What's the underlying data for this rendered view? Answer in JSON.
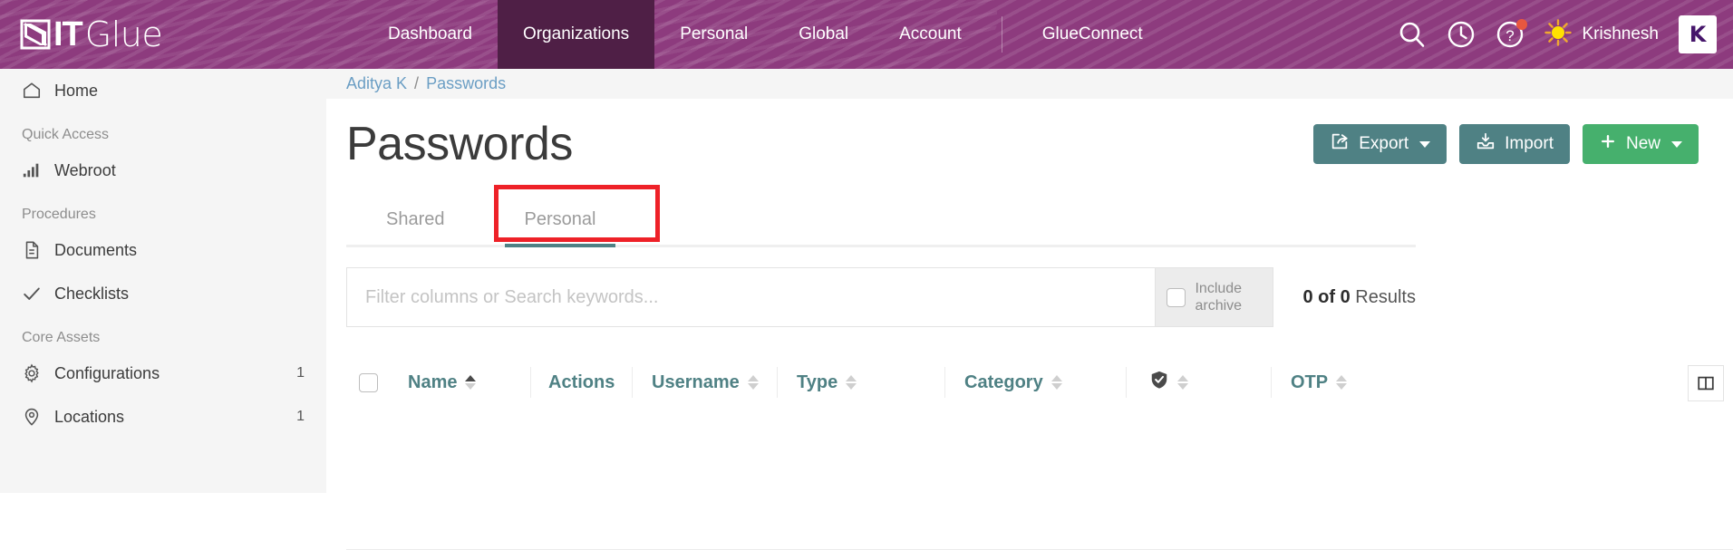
{
  "brand": {
    "logo_it": "IT",
    "logo_glue": "Glue",
    "purple": "#8d3b7e",
    "active_purple": "#4f1f46",
    "teal": "#4f8184",
    "green": "#46b06d",
    "annotation_red": "#ee2128"
  },
  "header": {
    "nav": [
      {
        "label": "Dashboard",
        "active": false
      },
      {
        "label": "Organizations",
        "active": true
      },
      {
        "label": "Personal",
        "active": false
      },
      {
        "label": "Global",
        "active": false
      },
      {
        "label": "Account",
        "active": false
      },
      {
        "label": "GlueConnect",
        "active": false
      }
    ],
    "icons": [
      "search-icon",
      "recent-history-icon",
      "help-icon"
    ],
    "help_has_notification": true,
    "user_name": "Krishnesh",
    "avatar_icon": "sun-avatar-icon",
    "kaseya_logo_letter": "K"
  },
  "sidebar": {
    "items": [
      {
        "label": "Home",
        "icon": "home-icon",
        "count": "",
        "group": false
      },
      {
        "label": "Quick Access",
        "icon": "",
        "count": "",
        "group": true
      },
      {
        "label": "Webroot",
        "icon": "signal-bars-icon",
        "count": "",
        "group": false
      },
      {
        "label": "Procedures",
        "icon": "",
        "count": "",
        "group": true
      },
      {
        "label": "Documents",
        "icon": "document-icon",
        "count": "",
        "group": false
      },
      {
        "label": "Checklists",
        "icon": "check-icon",
        "count": "",
        "group": false
      },
      {
        "label": "Core Assets",
        "icon": "",
        "count": "",
        "group": true
      },
      {
        "label": "Configurations",
        "icon": "gear-icon",
        "count": "1",
        "group": false
      },
      {
        "label": "Locations",
        "icon": "location-pin-icon",
        "count": "1",
        "group": false
      }
    ]
  },
  "breadcrumb": {
    "org": "Aditya K",
    "separator": "/",
    "current": "Passwords"
  },
  "main": {
    "title": "Passwords",
    "buttons": [
      {
        "label": "Export",
        "icon": "export-icon",
        "style": "teal",
        "caret": true
      },
      {
        "label": "Import",
        "icon": "import-icon",
        "style": "teal",
        "caret": false
      },
      {
        "label": "New",
        "icon": "plus-icon",
        "style": "green",
        "caret": true
      }
    ],
    "tabs": [
      {
        "label": "Shared",
        "active": false
      },
      {
        "label": "Personal",
        "active": true
      }
    ],
    "annotated_tab": "Personal",
    "search": {
      "value": "",
      "placeholder": "Filter columns or Search keywords...",
      "include_archive_label_line1": "Include",
      "include_archive_label_line2": "archive",
      "include_archive_checked": false
    },
    "results_text": {
      "prefix": "0 of 0",
      "suffix": "Results"
    },
    "table": {
      "select_all_checkbox": false,
      "columns": [
        {
          "label": "Name",
          "sortable": true,
          "sort": "asc",
          "icon": ""
        },
        {
          "label": "Actions",
          "sortable": false,
          "sort": "",
          "icon": ""
        },
        {
          "label": "Username",
          "sortable": true,
          "sort": "none",
          "icon": ""
        },
        {
          "label": "Type",
          "sortable": true,
          "sort": "none",
          "icon": ""
        },
        {
          "label": "Category",
          "sortable": true,
          "sort": "none",
          "icon": ""
        },
        {
          "label": "",
          "sortable": true,
          "sort": "none",
          "icon": "shield-check-icon"
        },
        {
          "label": "OTP",
          "sortable": true,
          "sort": "none",
          "icon": ""
        }
      ],
      "column_toggle_icon": "columns-layout-icon",
      "rows": []
    }
  }
}
